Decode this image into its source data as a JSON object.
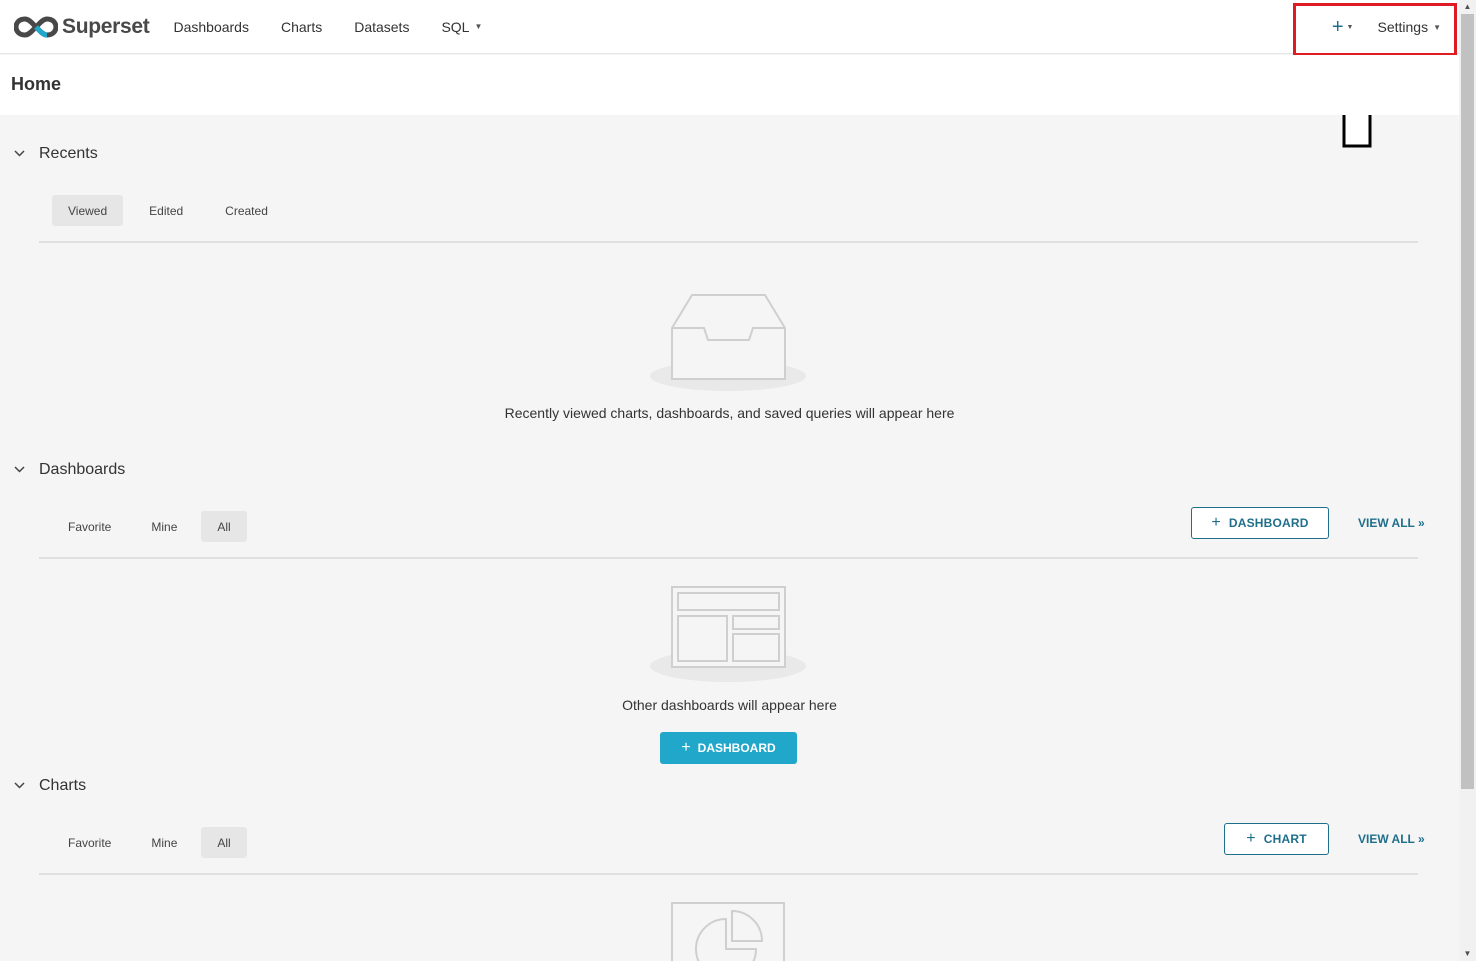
{
  "nav": {
    "brand": "Superset",
    "links": [
      "Dashboards",
      "Charts",
      "Datasets",
      "SQL"
    ],
    "plus_label": "+",
    "settings_label": "Settings"
  },
  "page": {
    "title": "Home"
  },
  "recents": {
    "title": "Recents",
    "tabs": [
      "Viewed",
      "Edited",
      "Created"
    ],
    "active_tab": "Viewed",
    "empty_text": "Recently viewed charts, dashboards, and saved queries will appear here"
  },
  "dashboards": {
    "title": "Dashboards",
    "tabs": [
      "Favorite",
      "Mine",
      "All"
    ],
    "active_tab": "All",
    "add_label": "DASHBOARD",
    "view_all": "VIEW ALL »",
    "empty_text": "Other dashboards will appear here",
    "empty_button": "DASHBOARD"
  },
  "charts": {
    "title": "Charts",
    "tabs": [
      "Favorite",
      "Mine",
      "All"
    ],
    "active_tab": "All",
    "add_label": "CHART",
    "view_all": "VIEW ALL »"
  },
  "colors": {
    "primary": "#20a7c9",
    "primary_dark": "#1f6f8b",
    "highlight": "#e01b24"
  }
}
